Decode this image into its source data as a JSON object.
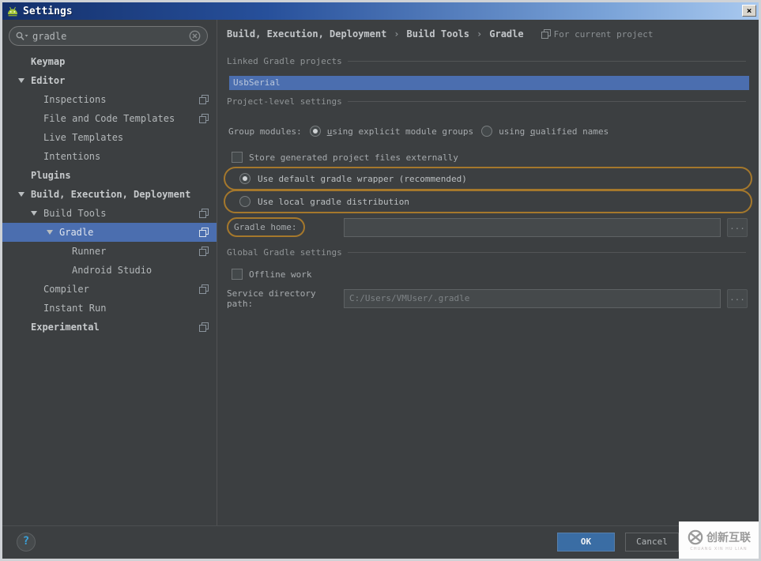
{
  "colors": {
    "selection_blue": "#4b6eaf",
    "search_highlight_orange": "#a5782c",
    "ok_button_blue": "#3a6da4",
    "titlebar_gradient": [
      "#14306b",
      "#a9c9ef"
    ],
    "android_green": "#a4c639",
    "panel_background": "#3c3f41"
  },
  "titlebar": {
    "title": "Settings",
    "close_label": "×"
  },
  "search": {
    "value": "gradle"
  },
  "sidebar": {
    "items": [
      {
        "id": "keymap",
        "label": "Keymap",
        "indent": 36,
        "bold": true,
        "arrow": false,
        "copy": false,
        "selected": false
      },
      {
        "id": "editor",
        "label": "Editor",
        "indent": 36,
        "bold": true,
        "arrow": true,
        "copy": false,
        "selected": false
      },
      {
        "id": "inspections",
        "label": "Inspections",
        "indent": 52,
        "bold": false,
        "arrow": false,
        "copy": true,
        "selected": false
      },
      {
        "id": "file-and-code-templates",
        "label": "File and Code Templates",
        "indent": 52,
        "bold": false,
        "arrow": false,
        "copy": true,
        "selected": false
      },
      {
        "id": "live-templates",
        "label": "Live Templates",
        "indent": 52,
        "bold": false,
        "arrow": false,
        "copy": false,
        "selected": false
      },
      {
        "id": "intentions",
        "label": "Intentions",
        "indent": 52,
        "bold": false,
        "arrow": false,
        "copy": false,
        "selected": false
      },
      {
        "id": "plugins",
        "label": "Plugins",
        "indent": 36,
        "bold": true,
        "arrow": false,
        "copy": false,
        "selected": false
      },
      {
        "id": "build-execution-deployment",
        "label": "Build, Execution, Deployment",
        "indent": 36,
        "bold": true,
        "arrow": true,
        "copy": false,
        "selected": false
      },
      {
        "id": "build-tools",
        "label": "Build Tools",
        "indent": 52,
        "bold": false,
        "arrow": true,
        "copy": true,
        "selected": false
      },
      {
        "id": "gradle",
        "label": "Gradle",
        "indent": 72,
        "bold": false,
        "arrow": true,
        "copy": true,
        "selected": true
      },
      {
        "id": "runner",
        "label": "Runner",
        "indent": 88,
        "bold": false,
        "arrow": false,
        "copy": true,
        "selected": false
      },
      {
        "id": "android-studio",
        "label": "Android Studio",
        "indent": 88,
        "bold": false,
        "arrow": false,
        "copy": false,
        "selected": false
      },
      {
        "id": "compiler",
        "label": "Compiler",
        "indent": 52,
        "bold": false,
        "arrow": false,
        "copy": true,
        "selected": false
      },
      {
        "id": "instant-run",
        "label": "Instant Run",
        "indent": 52,
        "bold": false,
        "arrow": false,
        "copy": false,
        "selected": false
      },
      {
        "id": "experimental",
        "label": "Experimental",
        "indent": 36,
        "bold": true,
        "arrow": false,
        "copy": true,
        "selected": false
      }
    ]
  },
  "breadcrumb": {
    "part1": "Build, Execution, Deployment",
    "part2": "Build Tools",
    "part3": "Gradle",
    "separator": "›",
    "scope": "For current project"
  },
  "main": {
    "linked_header": "Linked Gradle projects",
    "linked_project": "UsbSerial",
    "project_header": "Project-level settings",
    "group_modules_label": "Group modules:",
    "opt_explicit": {
      "pre": "",
      "u": "u",
      "post": "sing explicit module groups"
    },
    "opt_qualified": {
      "pre": "using ",
      "u": "q",
      "post": "ualified names"
    },
    "store_checkbox": "Store generated project files externally",
    "opt_wrapper": "Use default gradle wrapper (recommended)",
    "opt_local": "Use local gradle distribution",
    "gradle_home_label": "Gradle home:",
    "gradle_home_value": "",
    "browse_label": "...",
    "global_header": "Global Gradle settings",
    "offline_checkbox": "Offline work",
    "service_label": "Service directory path:",
    "service_value": "C:/Users/VMUser/.gradle"
  },
  "footer": {
    "help": "?",
    "ok": "OK",
    "cancel": "Cancel"
  },
  "watermark": {
    "brand": "创新互联",
    "sub": "CHUANG XIN HU LIAN"
  }
}
